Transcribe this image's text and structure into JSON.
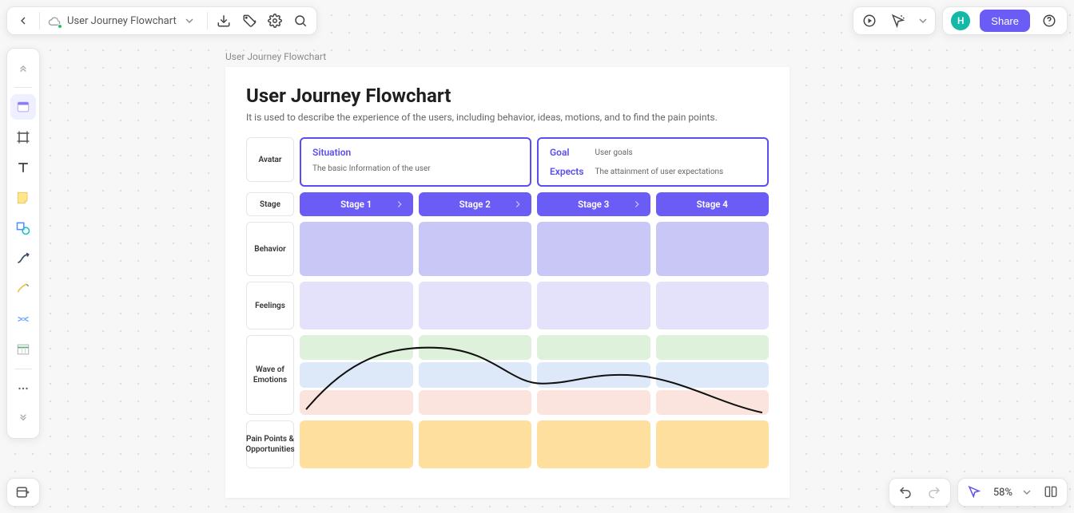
{
  "header": {
    "doc_title": "User Journey Flowchart",
    "share_label": "Share",
    "avatar_initial": "H"
  },
  "canvas": {
    "frame_label": "User Journey Flowchart",
    "title": "User Journey Flowchart",
    "subtitle": "It is used to describe the experience of the users, including behavior, ideas, motions, and to find the pain points.",
    "rows": {
      "avatar": "Avatar",
      "stage": "Stage",
      "behavior": "Behavior",
      "feelings": "Feelings",
      "emotions": "Wave of Emotions",
      "pain": "Pain Points & Opportunities"
    },
    "situation": {
      "label": "Situation",
      "desc": "The basic Information of the user"
    },
    "goal": {
      "label": "Goal",
      "desc": "User goals"
    },
    "expects": {
      "label": "Expects",
      "desc": "The attainment of user expectations"
    },
    "stages": [
      "Stage 1",
      "Stage 2",
      "Stage 3",
      "Stage 4"
    ]
  },
  "footer": {
    "zoom": "58%"
  }
}
